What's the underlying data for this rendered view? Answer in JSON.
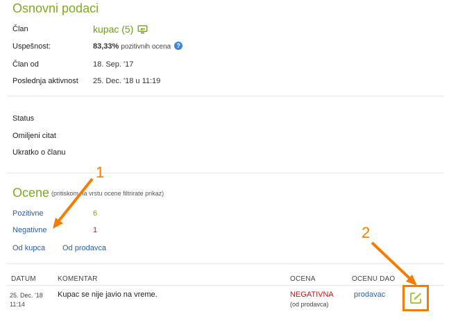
{
  "basic": {
    "title": "Osnovni podaci",
    "member_label": "Član",
    "member_value": "kupac (5)",
    "success_label": "Uspešnost:",
    "success_percent": "83,33%",
    "success_suffix": "pozitivnih ocena",
    "member_since_label": "Član od",
    "member_since_value": "18. Sep. '17",
    "last_activity_label": "Poslednja aktivnost",
    "last_activity_value": "25. Dec. '18 u 11:19"
  },
  "profile": {
    "status_label": "Status",
    "quote_label": "Omiljeni citat",
    "about_label": "Ukratko o članu"
  },
  "ratings": {
    "title": "Ocene",
    "hint": "(pritiskom na vrstu ocene filtrirate prikaz)",
    "positive_label": "Pozitivne",
    "positive_count": "6",
    "negative_label": "Negativne",
    "negative_count": "1",
    "from_buyer": "Od kupca",
    "from_seller": "Od prodavca"
  },
  "table": {
    "headers": [
      "DATUM",
      "KOMENTAR",
      "OCENA",
      "OCENU DAO"
    ],
    "rows": [
      {
        "date": "25. Dec. '18",
        "time": "11:14",
        "comment": "Kupac se nije javio na vreme.",
        "rating": "NEGATIVNA",
        "rating_sub": "(od prodavca)",
        "by": "prodavac"
      }
    ]
  },
  "annotations": {
    "one": "1",
    "two": "2"
  },
  "colors": {
    "accent_green": "#7cab1f",
    "link_blue": "#2b5fa8",
    "negative_red": "#c0161d",
    "annotation_orange": "#f57c00",
    "edit_icon_green": "#a8c93f"
  }
}
